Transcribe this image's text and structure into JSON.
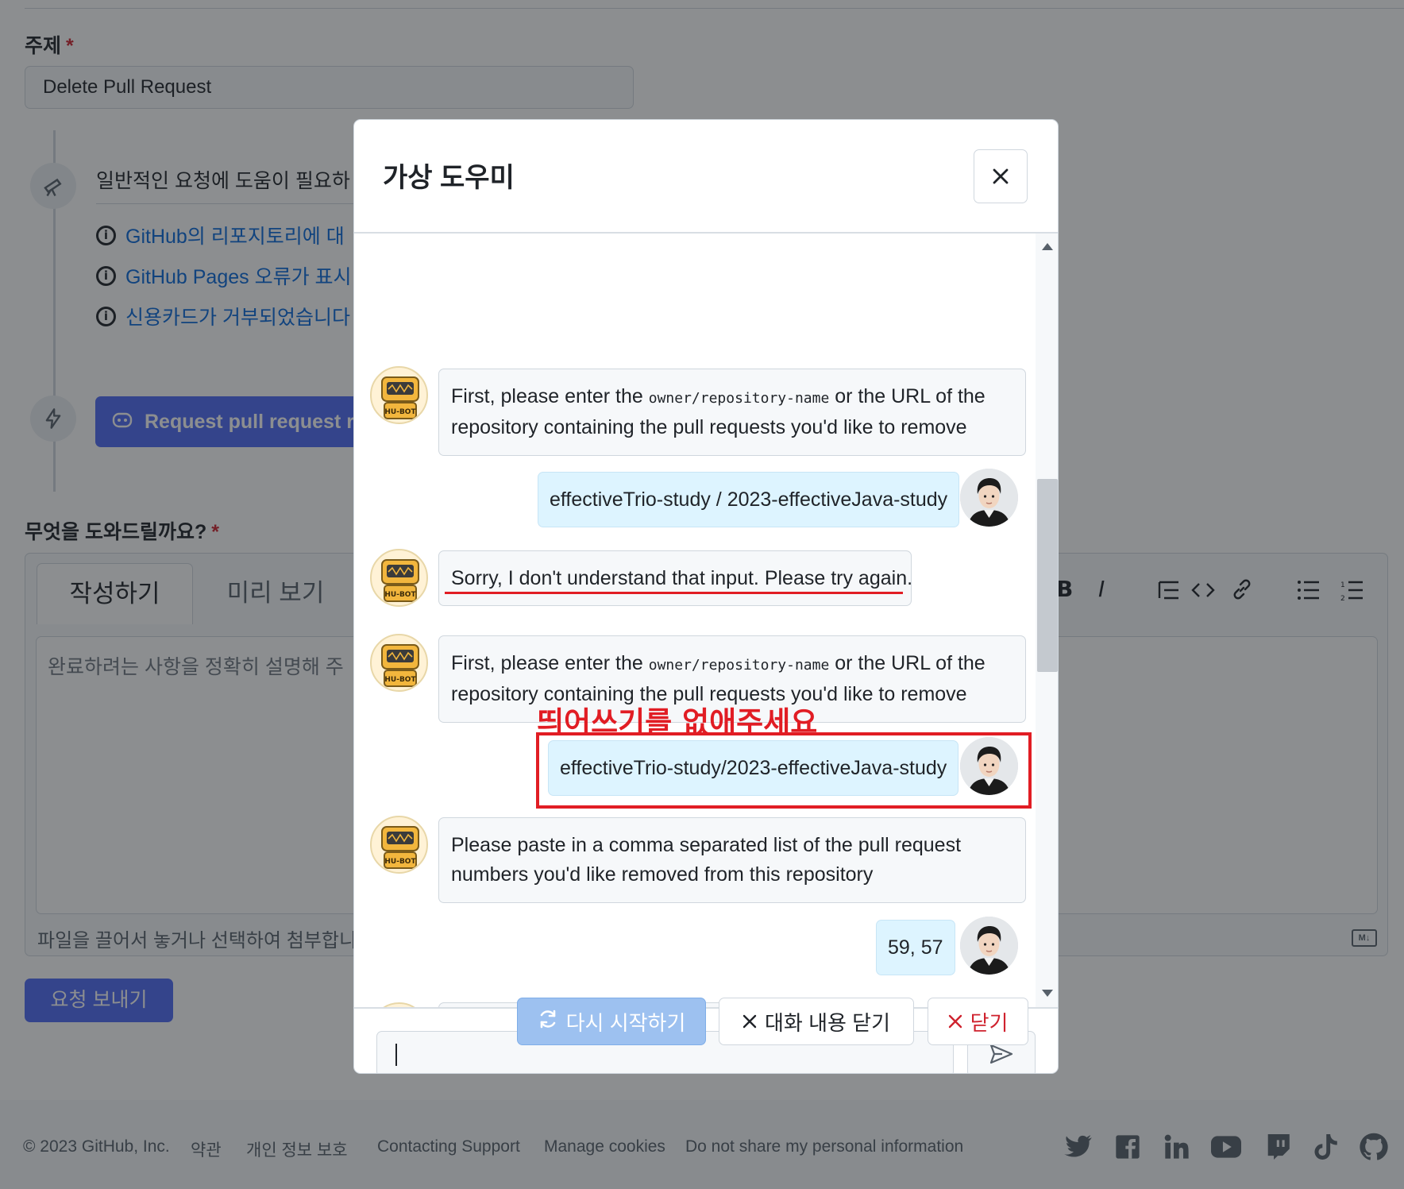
{
  "form": {
    "subject_label": "주제",
    "required_mark": "*",
    "subject_value": "Delete Pull Request",
    "suggest_heading": "일반적인 요청에 도움이 필요하",
    "links": [
      "GitHub의 리포지토리에 대",
      "GitHub Pages 오류가 표시",
      "신용카드가 거부되었습니다"
    ],
    "pr_button_label": "Request pull request ren",
    "help_label": "무엇을 도와드릴까요?",
    "tabs": [
      "작성하기",
      "미리 보기"
    ],
    "textarea_placeholder": "완료하려는 사항을 정확히 설명해 주",
    "attach_note": "파일을 끌어서 놓거나 선택하여 첨부합니",
    "markdown_badge": "M↓",
    "send_request_label": "요청 보내기",
    "toolbar_icons": [
      "bold-icon",
      "italic-icon",
      "quote-icon",
      "code-icon",
      "link-icon",
      "unordered-list-icon",
      "ordered-list-icon"
    ]
  },
  "modal": {
    "title": "가상 도우미",
    "input_value": "",
    "messages": [
      {
        "from": "bot",
        "parts": [
          "First, please enter the ",
          "owner/repository-name",
          " or the URL of the repository containing the pull requests you'd like to remove"
        ]
      },
      {
        "from": "user",
        "text": "effectiveTrio-study / 2023-effectiveJava-study"
      },
      {
        "from": "bot",
        "text": "Sorry, I don't understand that input. Please try again."
      },
      {
        "from": "bot",
        "parts": [
          "First, please enter the ",
          "owner/repository-name",
          " or the URL of the repository containing the pull requests you'd like to remove"
        ]
      },
      {
        "from": "user",
        "text": "effectiveTrio-study/2023-effectiveJava-study"
      },
      {
        "from": "bot",
        "text": "Please paste in a comma separated list of the pull request numbers you'd like removed from this repository"
      },
      {
        "from": "user",
        "text": "59, 57"
      }
    ],
    "bot_avatar_text": "HU-BOT",
    "buttons": {
      "restart": "다시 시작하기",
      "clear": "대화 내용 닫기",
      "close": "닫기"
    }
  },
  "annotation": {
    "text": "띄어쓰기를 없애주세요"
  },
  "footer": {
    "copyright": "© 2023 GitHub, Inc.",
    "links": [
      "약관",
      "개인 정보 보호",
      "Contacting Support",
      "Manage cookies",
      "Do not share my personal information"
    ],
    "social_icons": [
      "twitter-icon",
      "facebook-icon",
      "linkedin-icon",
      "youtube-icon",
      "twitch-icon",
      "tiktok-icon",
      "github-icon"
    ]
  },
  "colors": {
    "accent": "#4f6bf5",
    "link": "#0969da",
    "danger": "#cf222e",
    "annotation": "#e11d24",
    "user_bubble": "#ddf4ff"
  }
}
